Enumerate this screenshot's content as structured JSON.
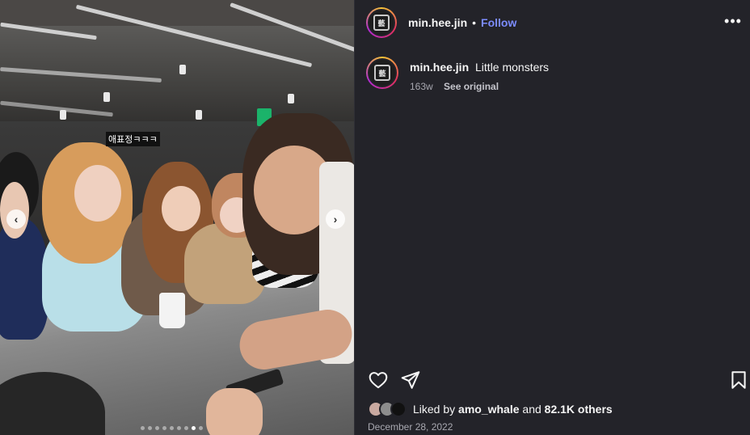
{
  "media": {
    "overlay_caption": "애표정ㅋㅋㅋ",
    "prev_icon": "chevron-left-icon",
    "next_icon": "chevron-right-icon",
    "carousel": {
      "total": 9,
      "active_index": 7
    }
  },
  "post": {
    "author": "min.hee.jin",
    "separator": "•",
    "follow_label": "Follow",
    "more_icon": "more-horizontal-icon",
    "avatar_mark": "藝",
    "caption": {
      "username": "min.hee.jin",
      "text": "Little monsters",
      "age": "163w",
      "see_original": "See original"
    },
    "actions": {
      "like_icon": "heart-icon",
      "share_icon": "send-icon",
      "save_icon": "bookmark-icon"
    },
    "likes": {
      "prefix": "Liked by",
      "user": "amo_whale",
      "middle": "and",
      "count": "82.1K others"
    },
    "date": "December 28, 2022"
  },
  "colors": {
    "panel_bg": "#232329",
    "follow": "#7c8cff",
    "muted_text": "#a8a8b0"
  }
}
